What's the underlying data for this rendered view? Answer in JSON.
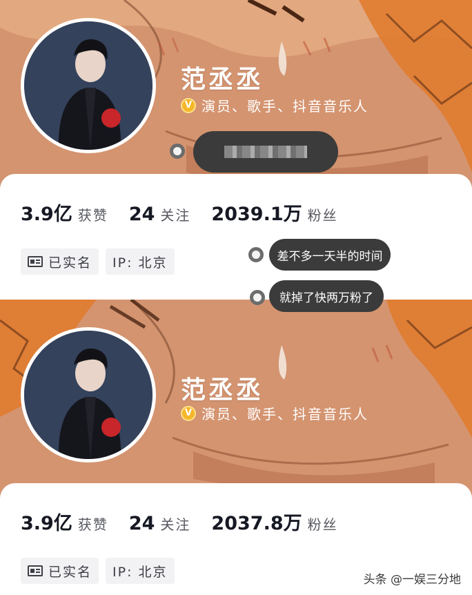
{
  "profiles": [
    {
      "name": "范丞丞",
      "verify_text": "演员、歌手、抖音音乐人",
      "stats": {
        "likes_num": "3.9亿",
        "likes_label": "获赞",
        "following_num": "24",
        "following_label": "关注",
        "followers_num": "2039.1万",
        "followers_label": "粉丝"
      },
      "tags": {
        "verified": "已实名",
        "ip": "IP: 北京"
      }
    },
    {
      "name": "范丞丞",
      "verify_text": "演员、歌手、抖音音乐人",
      "stats": {
        "likes_num": "3.9亿",
        "likes_label": "获赞",
        "following_num": "24",
        "following_label": "关注",
        "followers_num": "2037.8万",
        "followers_label": "粉丝"
      },
      "tags": {
        "verified": "已实名",
        "ip": "IP: 北京"
      }
    }
  ],
  "annotations": {
    "bubble_1": "差不多一天半的时间",
    "bubble_2": "就掉了快两万粉了"
  },
  "watermark": "头条 @一娱三分地",
  "colors": {
    "banner": "#c97f53",
    "verify_badge": "#f5b72a",
    "bubble_bg": "#3b3b3b"
  },
  "icons": {
    "verify": "v-badge-icon",
    "id_card": "id-card-icon"
  }
}
